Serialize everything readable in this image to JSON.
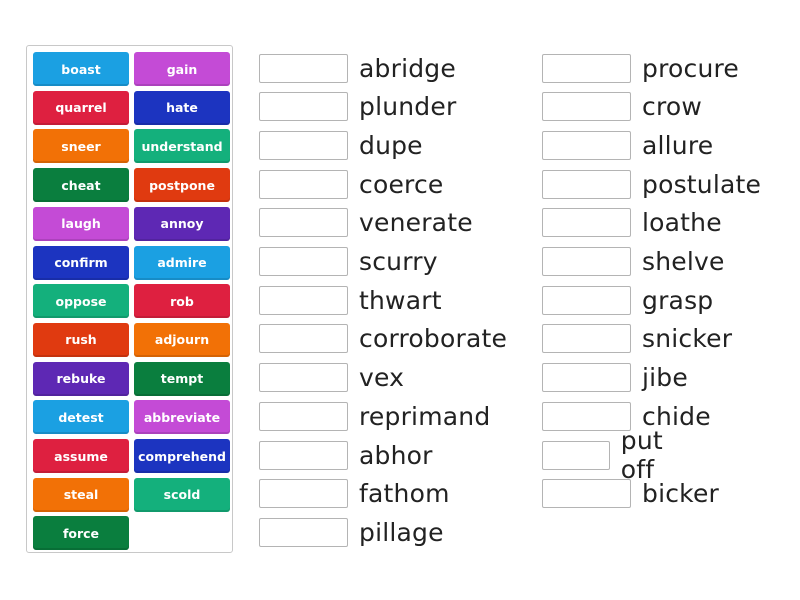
{
  "tiles": [
    {
      "label": "boast",
      "color": "#1ba0e2"
    },
    {
      "label": "gain",
      "color": "#c44bd6"
    },
    {
      "label": "quarrel",
      "color": "#de2040"
    },
    {
      "label": "hate",
      "color": "#1c34c0"
    },
    {
      "label": "sneer",
      "color": "#f27106"
    },
    {
      "label": "understand",
      "color": "#14b07c"
    },
    {
      "label": "cheat",
      "color": "#0a7e3e"
    },
    {
      "label": "postpone",
      "color": "#e03a10"
    },
    {
      "label": "laugh",
      "color": "#c44bd6"
    },
    {
      "label": "annoy",
      "color": "#5e28b4"
    },
    {
      "label": "confirm",
      "color": "#1c34c0"
    },
    {
      "label": "admire",
      "color": "#1ba0e2"
    },
    {
      "label": "oppose",
      "color": "#14b07c"
    },
    {
      "label": "rob",
      "color": "#de2040"
    },
    {
      "label": "rush",
      "color": "#e03a10"
    },
    {
      "label": "adjourn",
      "color": "#f27106"
    },
    {
      "label": "rebuke",
      "color": "#5e28b4"
    },
    {
      "label": "tempt",
      "color": "#0a7e3e"
    },
    {
      "label": "detest",
      "color": "#1ba0e2"
    },
    {
      "label": "abbreviate",
      "color": "#c44bd6"
    },
    {
      "label": "assume",
      "color": "#de2040"
    },
    {
      "label": "comprehend",
      "color": "#1c34c0"
    },
    {
      "label": "steal",
      "color": "#f27106"
    },
    {
      "label": "scold",
      "color": "#14b07c"
    },
    {
      "label": "force",
      "color": "#0a7e3e"
    }
  ],
  "targets_left": [
    "abridge",
    "plunder",
    "dupe",
    "coerce",
    "venerate",
    "scurry",
    "thwart",
    "corroborate",
    "vex",
    "reprimand",
    "abhor",
    "fathom",
    "pillage"
  ],
  "targets_right": [
    "procure",
    "crow",
    "allure",
    "postulate",
    "loathe",
    "shelve",
    "grasp",
    "snicker",
    "jibe",
    "chide",
    "put off",
    "bicker"
  ]
}
